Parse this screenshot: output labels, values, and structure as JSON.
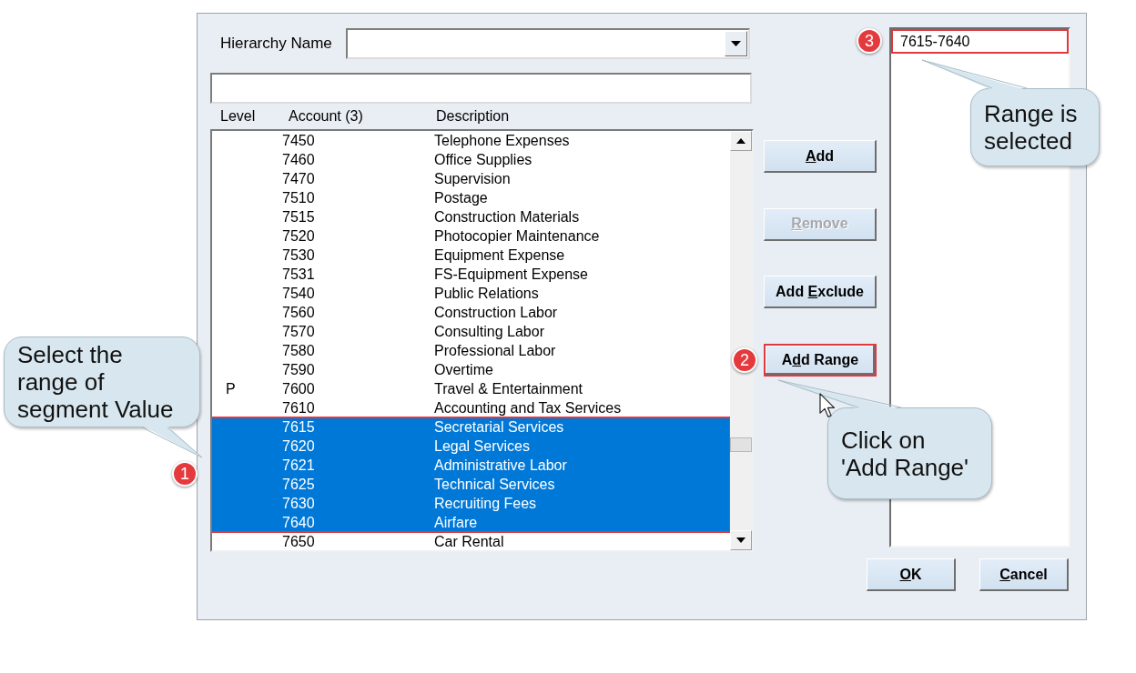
{
  "dialog": {
    "hierarchy_name": {
      "label": "Hierarchy Name"
    },
    "account_list": {
      "columns": [
        "Level",
        "Account (3)",
        "Description"
      ],
      "selection_outlined": true,
      "rows": [
        {
          "account": "7450",
          "description": "Telephone Expenses",
          "selected": false
        },
        {
          "account": "7460",
          "description": "Office Supplies",
          "selected": false
        },
        {
          "account": "7470",
          "description": "Supervision",
          "selected": false
        },
        {
          "account": "7510",
          "description": "Postage",
          "selected": false
        },
        {
          "account": "7515",
          "description": "Construction Materials",
          "selected": false
        },
        {
          "account": "7520",
          "description": "Photocopier Maintenance",
          "selected": false
        },
        {
          "account": "7530",
          "description": "Equipment Expense",
          "selected": false
        },
        {
          "account": "7531",
          "description": "FS-Equipment Expense",
          "selected": false
        },
        {
          "account": "7540",
          "description": "Public Relations",
          "selected": false
        },
        {
          "account": "7560",
          "description": "Construction Labor",
          "selected": false
        },
        {
          "account": "7570",
          "description": "Consulting Labor",
          "selected": false
        },
        {
          "account": "7580",
          "description": "Professional Labor",
          "selected": false
        },
        {
          "account": "7590",
          "description": "Overtime",
          "selected": false
        },
        {
          "level": "P",
          "account": "7600",
          "description": "Travel & Entertainment",
          "selected": false
        },
        {
          "account": "7610",
          "description": "Accounting and Tax Services",
          "selected": false
        },
        {
          "account": "7615",
          "description": "Secretarial Services",
          "selected": true
        },
        {
          "account": "7620",
          "description": "Legal Services",
          "selected": true
        },
        {
          "account": "7621",
          "description": "Administrative Labor",
          "selected": true
        },
        {
          "account": "7625",
          "description": "Technical Services",
          "selected": true
        },
        {
          "account": "7630",
          "description": "Recruiting Fees",
          "selected": true
        },
        {
          "account": "7640",
          "description": "Airfare",
          "selected": true
        },
        {
          "account": "7650",
          "description": "Car Rental",
          "selected": false
        }
      ]
    },
    "action_buttons": [
      {
        "access_key": "A",
        "label_after": "dd",
        "disabled": false,
        "outlined": false
      },
      {
        "access_key": "R",
        "label_after": "emove",
        "disabled": true,
        "outlined": false
      },
      {
        "label_before": "Add ",
        "access_key": "E",
        "label_after": "xclude",
        "disabled": false,
        "outlined": false
      },
      {
        "label_before": "A",
        "access_key": "d",
        "label_after": "d Range",
        "disabled": false,
        "outlined": true
      }
    ],
    "selected_values": [
      {
        "text": "7615-7640",
        "outlined": true
      }
    ],
    "footer_buttons": [
      {
        "access_key": "O",
        "label_after": "K"
      },
      {
        "access_key": "C",
        "label_after": "ancel"
      }
    ]
  },
  "annotations": [
    {
      "badge": "1",
      "callout_lines": [
        "Select the",
        "range of",
        "segment Value"
      ]
    },
    {
      "badge": "2",
      "callout_lines": [
        "Click on",
        "'Add Range'"
      ]
    },
    {
      "badge": "3",
      "callout_lines": [
        "Range is",
        "selected"
      ]
    }
  ]
}
